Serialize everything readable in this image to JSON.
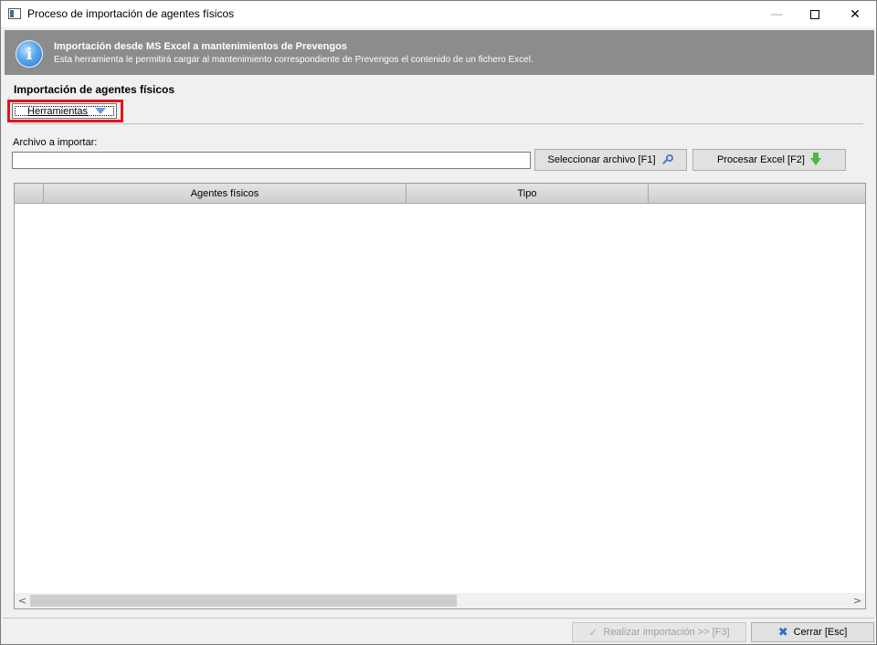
{
  "window": {
    "title": "Proceso de importación de agentes físicos",
    "minimize_symbol": "—",
    "close_symbol": "✕"
  },
  "banner": {
    "icon": "info-icon",
    "icon_glyph": "i",
    "title": "Importación desde MS Excel a mantenimientos de Prevengos",
    "subtitle": "Esta herramienta le permitirá cargar al mantenimiento correspondiente de Prevengos el contenido de un fichero Excel."
  },
  "section": {
    "title": "Importación de agentes físicos",
    "tools_button": "Herramientas"
  },
  "file": {
    "label": "Archivo a importar:",
    "value": "",
    "select_button": "Seleccionar archivo  [F1]",
    "process_button": "Procesar Excel  [F2]"
  },
  "grid": {
    "columns": [
      "",
      "Agentes físicos",
      "Tipo",
      ""
    ],
    "rows": [],
    "scroll_left": "<",
    "scroll_right": ">"
  },
  "footer": {
    "import_button": "Realizar importación >>  [F3]",
    "import_enabled": false,
    "close_button": "Cerrar  [Esc]"
  }
}
